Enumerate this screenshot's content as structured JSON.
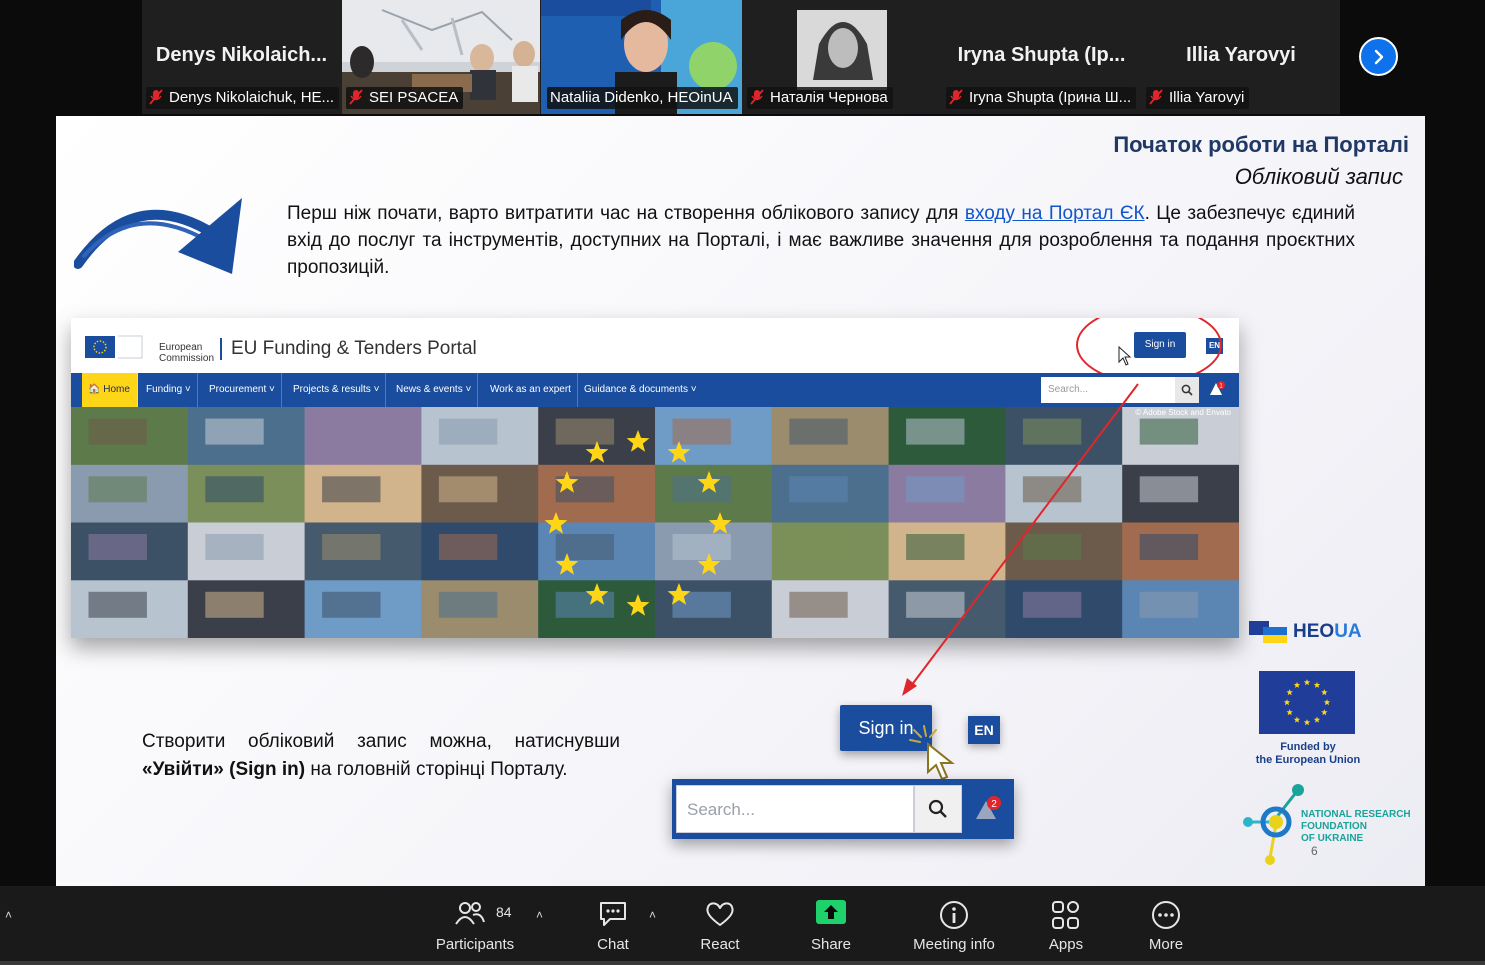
{
  "participants": [
    {
      "big_name": "Denys  Nikolaich...",
      "label": "Denys Nikolaichuk, HE...",
      "muted": true,
      "video": false
    },
    {
      "big_name": "",
      "label": "SEI PSACEA",
      "muted": true,
      "video": true
    },
    {
      "big_name": "",
      "label": "Nataliia Didenko, HEOinUA",
      "muted": false,
      "video": true,
      "active": true
    },
    {
      "big_name": "",
      "label": "Наталія Чернова",
      "muted": true,
      "video": true
    },
    {
      "big_name": "Iryna  Shupta  (Ip...",
      "label": "Iryna Shupta (Ірина Ш...",
      "muted": true,
      "video": false
    },
    {
      "big_name": "Illia Yarovyi",
      "label": "Illia Yarovyi",
      "muted": true,
      "video": false
    }
  ],
  "slide": {
    "title": "Початок роботи на Порталі",
    "subtitle": "Обліковий запис",
    "intro_before": "Перш ніж почати, варто витратити час на створення облікового запису для ",
    "intro_link": "входу на Портал ЄК",
    "intro_after": ". Це забезпечує єдиний вхід до послуг та інструментів, доступних на Порталі, і має важливе значення для розроблення та подання проєктних пропозицій.",
    "bottom_before": "Створити обліковий запис можна, натиснувши ",
    "bottom_bold": "«Увійти» (Sign in)",
    "bottom_after": " на головній сторінці Порталу.",
    "page_number": "6"
  },
  "portal": {
    "ec_line1": "European",
    "ec_line2": "Commission",
    "name": "EU Funding & Tenders Portal",
    "signin": "Sign in",
    "lang": "EN",
    "nav": [
      "Home",
      "Funding",
      "Procurement",
      "Projects & results",
      "News & events",
      "Work as an expert",
      "Guidance & documents"
    ],
    "search_placeholder": "Search...",
    "bell_badge": "1",
    "copyright": "© Adobe Stock and Envato"
  },
  "zoomed": {
    "signin": "Sign in",
    "lang": "EN",
    "search_placeholder": "Search...",
    "bell_badge": "2"
  },
  "logos": {
    "heoinua": "HEOINUA",
    "heo_part": "HEO",
    "ua_part": "UA",
    "funded_line1": "Funded by",
    "funded_line2": "the European Union",
    "nrfu_line1": "NATIONAL RESEARCH",
    "nrfu_line2": "FOUNDATION",
    "nrfu_line3": "OF UKRAINE"
  },
  "toolbar": {
    "participants_label": "Participants",
    "participants_count": "84",
    "chat_label": "Chat",
    "react_label": "React",
    "share_label": "Share",
    "meeting_info_label": "Meeting info",
    "apps_label": "Apps",
    "more_label": "More"
  },
  "colors": {
    "portal_blue": "#1a4d9e",
    "eu_yellow": "#ffd617",
    "zoom_active": "#18d87a",
    "zoom_blue": "#0e72ed",
    "share_green": "#1fd16b",
    "annotation_red": "#e0262b"
  }
}
